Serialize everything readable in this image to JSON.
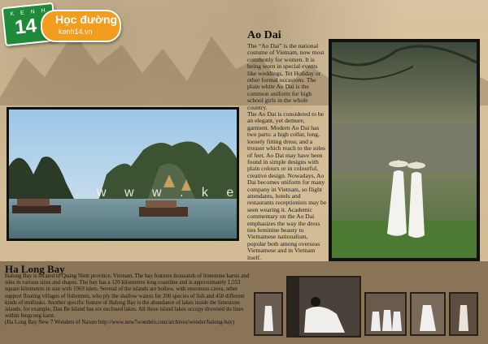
{
  "logo": {
    "badge_top": "K E N H",
    "badge_number": "14",
    "title": "Học đường",
    "subtitle": "kenh14.vn"
  },
  "watermark": "w w w . k e n 1 4 . v n",
  "ao_dai": {
    "title": "Ao Dai",
    "paragraphs": [
      "The “Ao Dai” is the national costume of Vietnam, now most commonly for women. It is being  worn in special events like weddings, Tet Holiday or other formal occasions. The plain white Ao Dai is the common uniform for high school girls in the whole country.",
      "The Ao Dai is considered to be an elegant, yet demure, garment. Modern Ao Dai has two parts: a high collar, long, loosely fitting dress; and a trouser which reach to the soles of feet. Ao Dai may have been found in simple designs with plain colours or in colourful, creative design. Nowadays, Ao Dai becomes uniform for many  company in Vietnam, so flight attendants, hotels and restaurants receptionists may be seen wearing it. Academic commentary on the Ao Dai emphasizes the way the dress ties feminine beauty to Vietnamese nationalism, popular both among overseas Vietnamese and in Vietnam itself."
    ]
  },
  "ha_long": {
    "title": "Ha Long Bay",
    "paragraphs": [
      "Halong Bay is located in Quảng Ninh province, Vietnam. The bay features thousands of limestone karsts and isles in various sizes and shapes. The bay has a 120 kilometres long coastline and is approximately 1,553 square kilometres in size with 1969 islets. Several of the islands are hollow, with enormous caves, other support floating villages of fishermen, who ply the shallow waters for 200 species of fish and 450 different kinds of mollusks. Another specific feature of Halong Bay is the abundance of lakes inside the limestone islands, for example, Dau Be Island has six enclosed lakes. All these island lakes occupy drowned do lines within fengcong karst.",
      "(Ha Long Bay New 7 Wonders of Nature http://www.new7wonders.com/archives/wonder/halong-bay)"
    ]
  },
  "colors": {
    "background": "#d5bf98",
    "band": "#6b5338",
    "logo_green": "#1f8a3a",
    "logo_orange": "#f39c1e"
  }
}
